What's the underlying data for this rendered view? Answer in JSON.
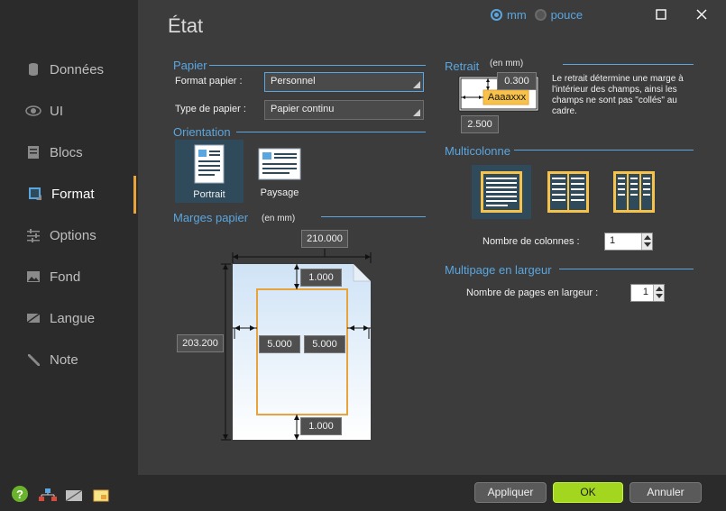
{
  "title": "État",
  "units": {
    "mm_label": "mm",
    "inch_label": "pouce",
    "selected": "mm"
  },
  "sidebar": {
    "items": [
      {
        "label": "Données",
        "icon": "database-icon"
      },
      {
        "label": "UI",
        "icon": "eye-icon"
      },
      {
        "label": "Blocs",
        "icon": "blocks-icon"
      },
      {
        "label": "Format",
        "icon": "format-icon"
      },
      {
        "label": "Options",
        "icon": "sliders-icon"
      },
      {
        "label": "Fond",
        "icon": "image-icon"
      },
      {
        "label": "Langue",
        "icon": "language-icon"
      },
      {
        "label": "Note",
        "icon": "pencil-icon"
      }
    ],
    "active": "Format"
  },
  "papier": {
    "header": "Papier",
    "format_label": "Format papier :",
    "format_value": "Personnel",
    "type_label": "Type de papier :",
    "type_value": "Papier continu"
  },
  "orientation": {
    "header": "Orientation",
    "portrait_label": "Portrait",
    "paysage_label": "Paysage",
    "selected": "Portrait"
  },
  "marges": {
    "header": "Marges papier",
    "unit_note": "(en mm)",
    "width": "210.000",
    "height": "203.200",
    "top": "1.000",
    "left": "5.000",
    "right": "5.000",
    "bottom": "1.000"
  },
  "retrait": {
    "header": "Retrait",
    "unit_note": "(en mm)",
    "top_value": "0.300",
    "left_value": "2.500",
    "sample_text": "Aaaaxxx",
    "description": "Le retrait détermine une marge à l'intérieur des champs, ainsi les champs ne sont pas \"collés\" au cadre."
  },
  "multicolonne": {
    "header": "Multicolonne",
    "columns_label": "Nombre de colonnes :",
    "columns_value": "1",
    "selected": 1
  },
  "multipage": {
    "header": "Multipage en largeur",
    "pages_label": "Nombre de pages en largeur :",
    "pages_value": "1"
  },
  "footer": {
    "apply_label": "Appliquer",
    "ok_label": "OK",
    "cancel_label": "Annuler"
  },
  "colors": {
    "accent": "#5aa6e0",
    "highlight": "#e8a33a",
    "ok_green": "#a3d61e",
    "selected_bg": "#2f4a5a"
  }
}
